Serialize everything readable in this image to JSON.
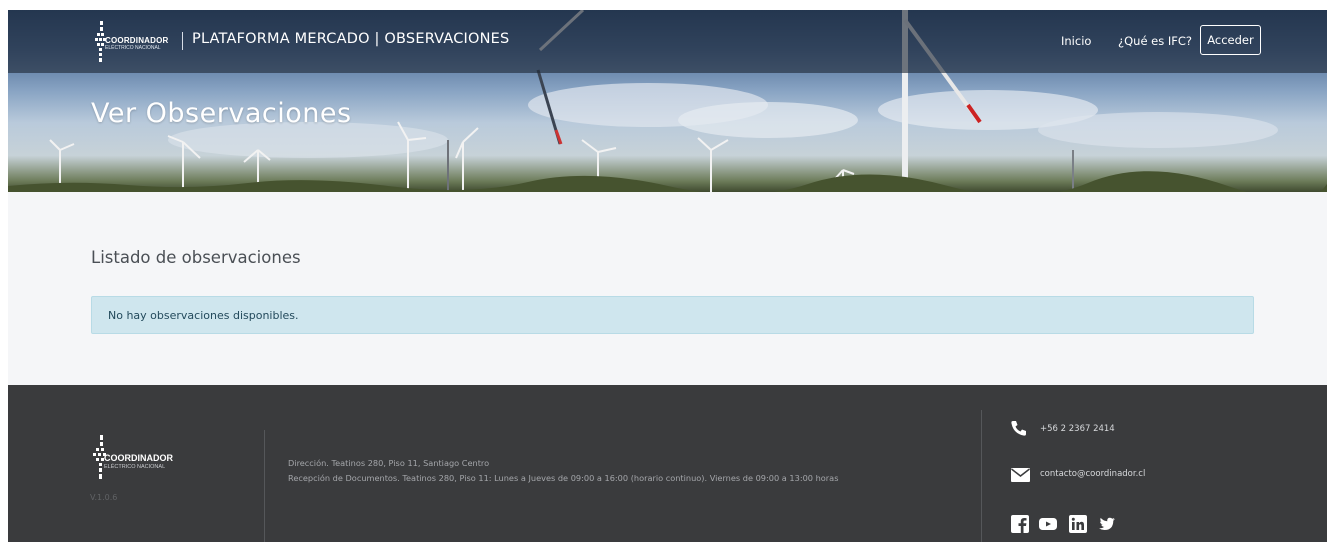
{
  "header": {
    "logo_text": "COORDINADOR",
    "logo_sub": "ELÉCTRICO NACIONAL",
    "title": "PLATAFORMA MERCADO | OBSERVACIONES",
    "nav": [
      {
        "label": "Inicio"
      },
      {
        "label": "¿Qué es IFC?"
      },
      {
        "label": "Acceder"
      }
    ]
  },
  "hero": {
    "title": "Ver Observaciones"
  },
  "main": {
    "section_title": "Listado de observaciones",
    "alert": "No hay observaciones disponibles."
  },
  "footer": {
    "logo_text": "COORDINADOR",
    "logo_sub": "ELÉCTRICO NACIONAL",
    "version": "V.1.0.6",
    "address_line1": "Dirección. Teatinos 280, Piso 11, Santiago Centro",
    "address_line2": "Recepción de Documentos. Teatinos 280, Piso 11: Lunes a Jueves de 09:00 a 16:00 (horario continuo). Viernes de 09:00 a 13:00 horas",
    "phone": "+56 2 2367 2414",
    "email": "contacto@coordinador.cl",
    "social": [
      "facebook-icon",
      "youtube-icon",
      "linkedin-icon",
      "twitter-icon"
    ]
  },
  "colors": {
    "topbar": "#1e2837",
    "alert_bg": "#cfe6ee",
    "footer_bg": "#3a3b3d",
    "main_bg": "#f5f6f8"
  }
}
